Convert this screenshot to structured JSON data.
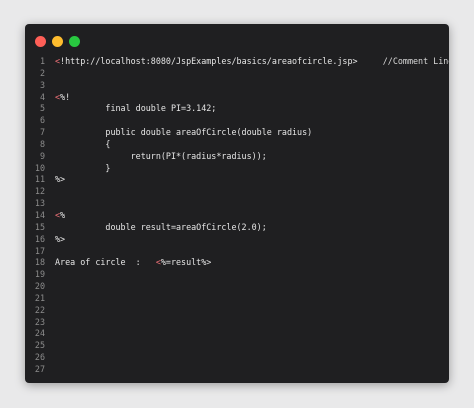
{
  "window": {
    "buttons": {
      "close": "close",
      "minimize": "minimize",
      "maximize": "maximize"
    },
    "colors": {
      "close": "#ff5f57",
      "minimize": "#febc2e",
      "maximize": "#28c840",
      "tag": "#f07178",
      "text": "#e6e6e6",
      "line_number": "#8c8c8c"
    }
  },
  "editor": {
    "lines": [
      {
        "num": "1",
        "tag": "<",
        "text": "!http://localhost:8080/JspExamples/basics/areaofcircle.jsp>",
        "comment": "     //Comment Line"
      },
      {
        "num": "2",
        "tag": "",
        "text": "",
        "comment": ""
      },
      {
        "num": "3",
        "tag": "",
        "text": "",
        "comment": ""
      },
      {
        "num": "4",
        "tag": "<",
        "text": "%!",
        "comment": ""
      },
      {
        "num": "5",
        "tag": "",
        "text": "          final double PI=3.142;",
        "comment": ""
      },
      {
        "num": "6",
        "tag": "",
        "text": "",
        "comment": ""
      },
      {
        "num": "7",
        "tag": "",
        "text": "          public double areaOfCircle(double radius)",
        "comment": ""
      },
      {
        "num": "8",
        "tag": "",
        "text": "          {",
        "comment": ""
      },
      {
        "num": "9",
        "tag": "",
        "text": "               return(PI*(radius*radius));",
        "comment": ""
      },
      {
        "num": "10",
        "tag": "",
        "text": "          }",
        "comment": ""
      },
      {
        "num": "11",
        "tag": "",
        "text": "%>",
        "comment": ""
      },
      {
        "num": "12",
        "tag": "",
        "text": "",
        "comment": ""
      },
      {
        "num": "13",
        "tag": "",
        "text": "",
        "comment": ""
      },
      {
        "num": "14",
        "tag": "<",
        "text": "%",
        "comment": ""
      },
      {
        "num": "15",
        "tag": "",
        "text": "          double result=areaOfCircle(2.0);",
        "comment": ""
      },
      {
        "num": "16",
        "tag": "",
        "text": "%>",
        "comment": ""
      },
      {
        "num": "17",
        "tag": "",
        "text": "",
        "comment": ""
      },
      {
        "num": "18",
        "tag": "",
        "text": "Area of circle  :   ",
        "tag2": "<",
        "text2": "%=result%>",
        "comment": ""
      },
      {
        "num": "19",
        "tag": "",
        "text": "",
        "comment": ""
      },
      {
        "num": "20",
        "tag": "",
        "text": "",
        "comment": ""
      },
      {
        "num": "21",
        "tag": "",
        "text": "",
        "comment": ""
      },
      {
        "num": "22",
        "tag": "",
        "text": "",
        "comment": ""
      },
      {
        "num": "23",
        "tag": "",
        "text": "",
        "comment": ""
      },
      {
        "num": "24",
        "tag": "",
        "text": "",
        "comment": ""
      },
      {
        "num": "25",
        "tag": "",
        "text": "",
        "comment": ""
      },
      {
        "num": "26",
        "tag": "",
        "text": "",
        "comment": ""
      },
      {
        "num": "27",
        "tag": "",
        "text": "",
        "comment": ""
      }
    ]
  }
}
